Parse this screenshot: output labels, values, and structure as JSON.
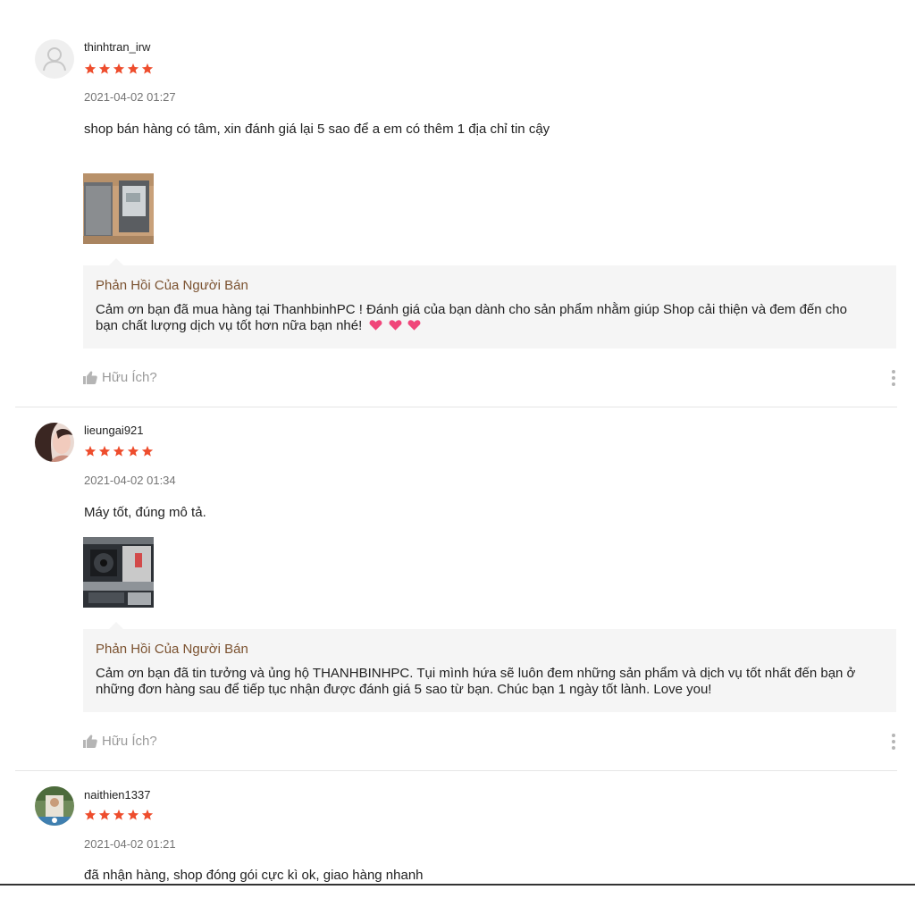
{
  "reviews": [
    {
      "username": "thinhtran_irw",
      "rating": 5,
      "date": "2021-04-02 01:27",
      "comment": "shop bán hàng có tâm, xin đánh giá lại 5 sao để a em có thêm 1 địa chỉ tin cậy",
      "reply_title": "Phản Hồi Của Người Bán",
      "reply_line1": "Cảm ơn bạn đã mua hàng tại ThanhbinhPC ! Đánh giá của bạn dành cho sản phẩm nhằm giúp Shop cải thiện và đem đến cho",
      "reply_line2": "bạn chất lượng dịch vụ tốt hơn nữa bạn nhé!",
      "helpful": "Hữu Ích?"
    },
    {
      "username": "lieungai921",
      "rating": 5,
      "date": "2021-04-02 01:34",
      "comment": "Máy tốt, đúng mô tả.",
      "reply_title": "Phản Hồi Của Người Bán",
      "reply_line1": "Cảm ơn bạn đã tin tưởng và ủng hộ THANHBINHPC. Tụi mình hứa sẽ luôn đem những sản phẩm và dịch vụ tốt nhất đến bạn ở",
      "reply_line2": "những đơn hàng sau để tiếp tục nhận được đánh giá 5 sao từ bạn. Chúc bạn 1 ngày tốt lành. Love you!",
      "helpful": "Hữu Ích?"
    },
    {
      "username": "naithien1337",
      "rating": 5,
      "date": "2021-04-02 01:21",
      "comment": "đã nhận hàng, shop đóng gói cực kì ok, giao hàng nhanh"
    }
  ],
  "colors": {
    "star": "#ee4d2d",
    "reply_title": "#7b5230",
    "reply_bg": "#f5f5f5",
    "muted": "#9a9a9a",
    "heart": "#f0467a"
  },
  "icons": {
    "avatar_placeholder": "user-silhouette-icon",
    "thumbs_up": "thumbs-up-icon",
    "more": "more-vertical-icon",
    "heart": "sparkling-heart-icon"
  }
}
